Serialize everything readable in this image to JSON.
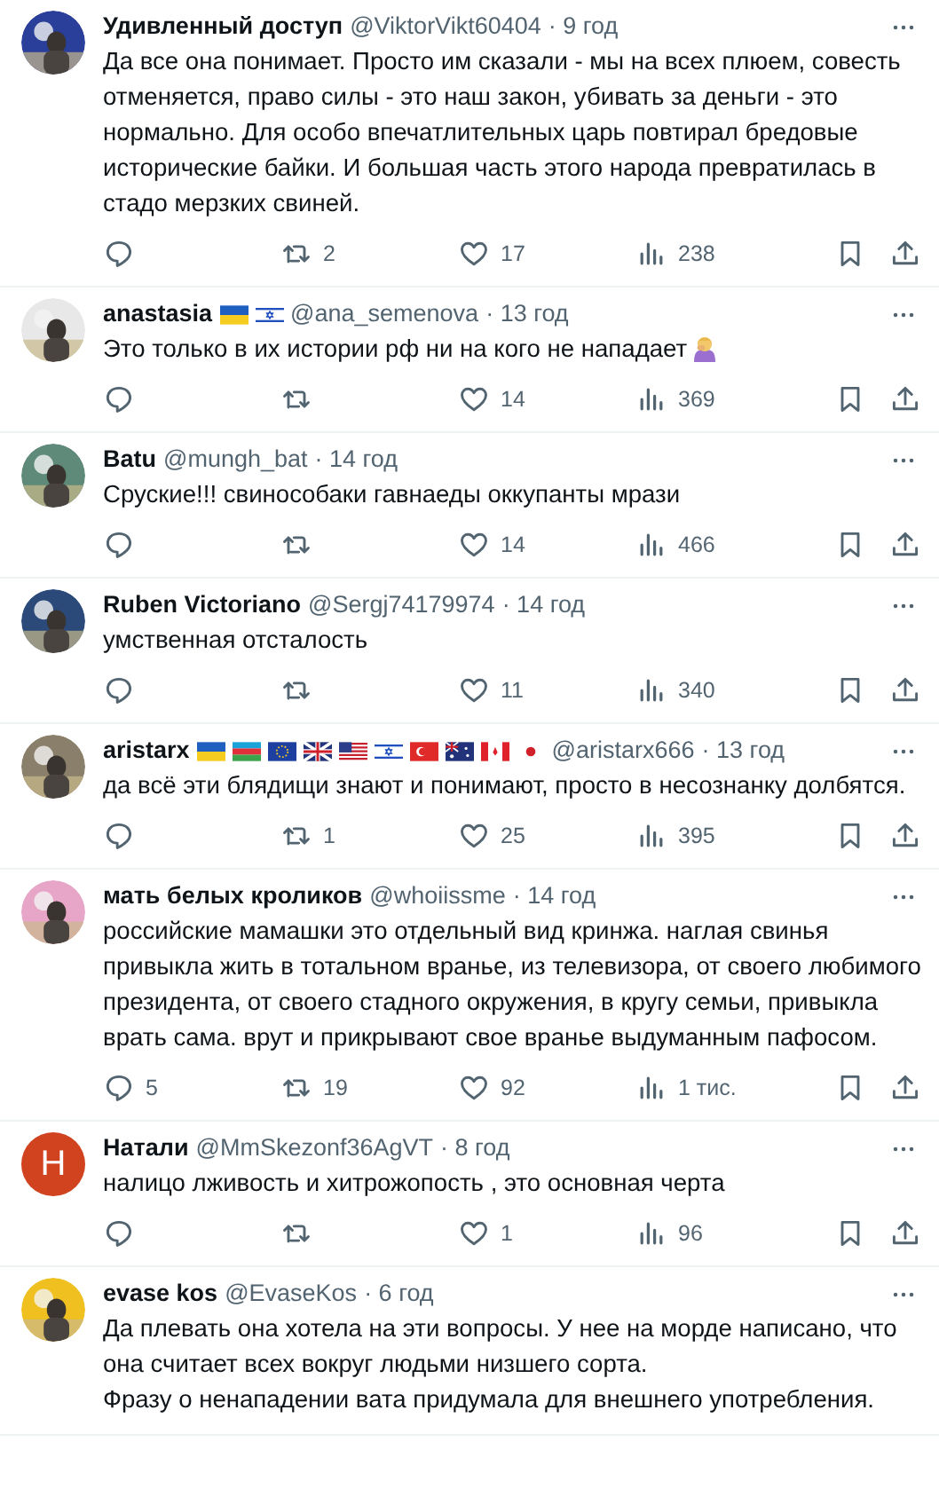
{
  "posts": [
    {
      "name": "Удивленный доступ",
      "handle": "@ViktorVikt60404",
      "time": "· 9 год",
      "text": "Да все она понимает. Просто им сказали - мы  на всех плюем, совесть отменяется, право силы - это наш закон, убивать за деньги - это нормально. Для особо впечатлительных царь повтирал бредовые исторические  байки. И большая часть этого народа превратилась в стадо мерзких свиней.",
      "actions": {
        "reposts": "2",
        "likes": "17",
        "views": "238"
      }
    },
    {
      "name": "anastasia",
      "flags": [
        {
          "kind": "ua"
        },
        {
          "kind": "il"
        }
      ],
      "handle": "@ana_semenova",
      "time": "· 13 год",
      "text": "Это только в их истории рф ни на кого не нападает",
      "emoji": {
        "kind": "facepalm"
      },
      "actions": {
        "likes": "14",
        "views": "369"
      }
    },
    {
      "name": "Batu",
      "handle": "@mungh_bat",
      "time": "· 14 год",
      "text": "Сруские!!! свиноcобаки гавнаеды оккупанты мрази",
      "actions": {
        "likes": "14",
        "views": "466"
      }
    },
    {
      "name": "Ruben Victoriano",
      "handle": "@Sergj74179974",
      "time": "· 14 год",
      "text": "умственная отсталость",
      "actions": {
        "likes": "11",
        "views": "340"
      }
    },
    {
      "name": "aristarx",
      "flags": [
        {
          "kind": "ua"
        },
        {
          "kind": "az"
        },
        {
          "kind": "eu"
        },
        {
          "kind": "gb"
        },
        {
          "kind": "us"
        },
        {
          "kind": "il"
        },
        {
          "kind": "tr"
        },
        {
          "kind": "au"
        },
        {
          "kind": "ca"
        },
        {
          "kind": "jp"
        }
      ],
      "handle": "@aristarx666",
      "time": "· 13 год",
      "text": "да всё эти блядищи знают и понимают, просто в несознанку долбятся.",
      "actions": {
        "reposts": "1",
        "likes": "25",
        "views": "395"
      }
    },
    {
      "name": "мать белых кроликов",
      "handle": "@whoiissme",
      "time": "· 14 год",
      "text": "российские мамашки это отдельный вид кринжа. наглая свинья привыкла жить в тотальном вранье, из телевизора, от своего любимого президента, от своего стадного окружения, в кругу семьи, привыкла врать сама. врут и прикрывают свое вранье выдуманным пафосом.",
      "actions": {
        "replies": "5",
        "reposts": "19",
        "likes": "92",
        "views": "1 тис."
      }
    },
    {
      "avatar": {
        "kind": "letter",
        "letter": "Н"
      },
      "name": "Натали",
      "handle": "@MmSkezonf36AgVT",
      "time": "· 8 год",
      "text": "налицо лживость и хитрожопость , это основная черта",
      "actions": {
        "likes": "1",
        "views": "96"
      }
    },
    {
      "name": "evase kos",
      "handle": "@EvaseKos",
      "time": "· 6 год",
      "text": "Да плевать она хотела на эти вопросы. У нее на морде написано, что она считает всех вокруг людьми низшего сорта.\nФразу о ненападении вата придумала для внешнего употребления."
    }
  ]
}
